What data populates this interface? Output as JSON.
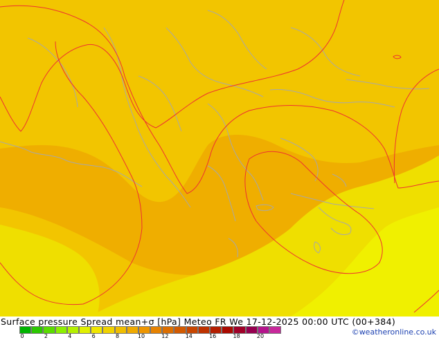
{
  "map": {
    "background_color": "#f2c500",
    "region_colors": {
      "darker_band": "#efae00",
      "light_yellow": "#efdf00",
      "lightest_yellow": "#f0f000",
      "contour_line": "#ee3030",
      "coastline": "#a8a8a8"
    }
  },
  "footer": {
    "title": "Surface pressure Spread mean+σ [hPa] Meteo FR We 17-12-2025 00:00 UTC (00+384)",
    "credit": "©weatheronline.co.uk"
  },
  "colorbar": {
    "colors": [
      "#00b400",
      "#2cc800",
      "#5adc00",
      "#8cf000",
      "#b4f000",
      "#e1f000",
      "#f0e600",
      "#f0d200",
      "#f0be00",
      "#f0aa00",
      "#ee9600",
      "#e68200",
      "#dc6e00",
      "#d25a00",
      "#c84600",
      "#be3200",
      "#b41e00",
      "#aa0a00",
      "#a00028",
      "#960050",
      "#b4148c",
      "#c8289b"
    ],
    "tick_labels": [
      "0",
      "2",
      "4",
      "6",
      "8",
      "10",
      "12",
      "14",
      "16",
      "18",
      "20"
    ]
  }
}
